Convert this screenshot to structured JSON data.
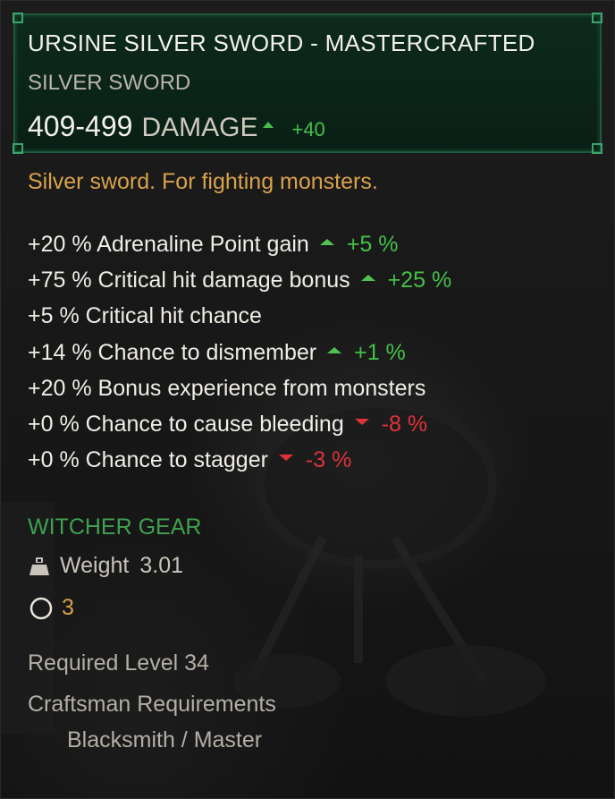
{
  "item": {
    "name": "URSINE SILVER SWORD - MASTERCRAFTED",
    "type": "SILVER SWORD",
    "damage_value": "409-499",
    "damage_label": "DAMAGE",
    "damage_delta": "+40",
    "damage_trend": "up",
    "description": "Silver sword. For fighting monsters."
  },
  "stats": [
    {
      "text": "+20 % Adrenaline Point gain",
      "trend": "up",
      "delta": "+5 %"
    },
    {
      "text": "+75 % Critical hit damage bonus",
      "trend": "up",
      "delta": "+25 %"
    },
    {
      "text": "+5 % Critical hit chance",
      "trend": "none",
      "delta": ""
    },
    {
      "text": "+14 % Chance to dismember",
      "trend": "up",
      "delta": "+1 %"
    },
    {
      "text": "+20 % Bonus experience from monsters",
      "trend": "none",
      "delta": ""
    },
    {
      "text": "+0 % Chance to cause bleeding",
      "trend": "down",
      "delta": "-8 %"
    },
    {
      "text": "+0 % Chance to stagger",
      "trend": "down",
      "delta": "-3 %"
    }
  ],
  "gear": {
    "set_label": "WITCHER GEAR",
    "weight_label": "Weight",
    "weight_value": "3.01",
    "weight_icon": "weight-icon",
    "slots_icon": "circle-slot-icon",
    "slots_value": "3"
  },
  "requirements": {
    "level": "Required Level 34",
    "craftsman_title": "Craftsman Requirements",
    "craftsman_value": "Blacksmith / Master"
  },
  "colors": {
    "header_border": "#1f5a3c",
    "positive": "#45c04a",
    "negative": "#e0323a",
    "description": "#d9a24a",
    "set_label": "#3fa150"
  }
}
